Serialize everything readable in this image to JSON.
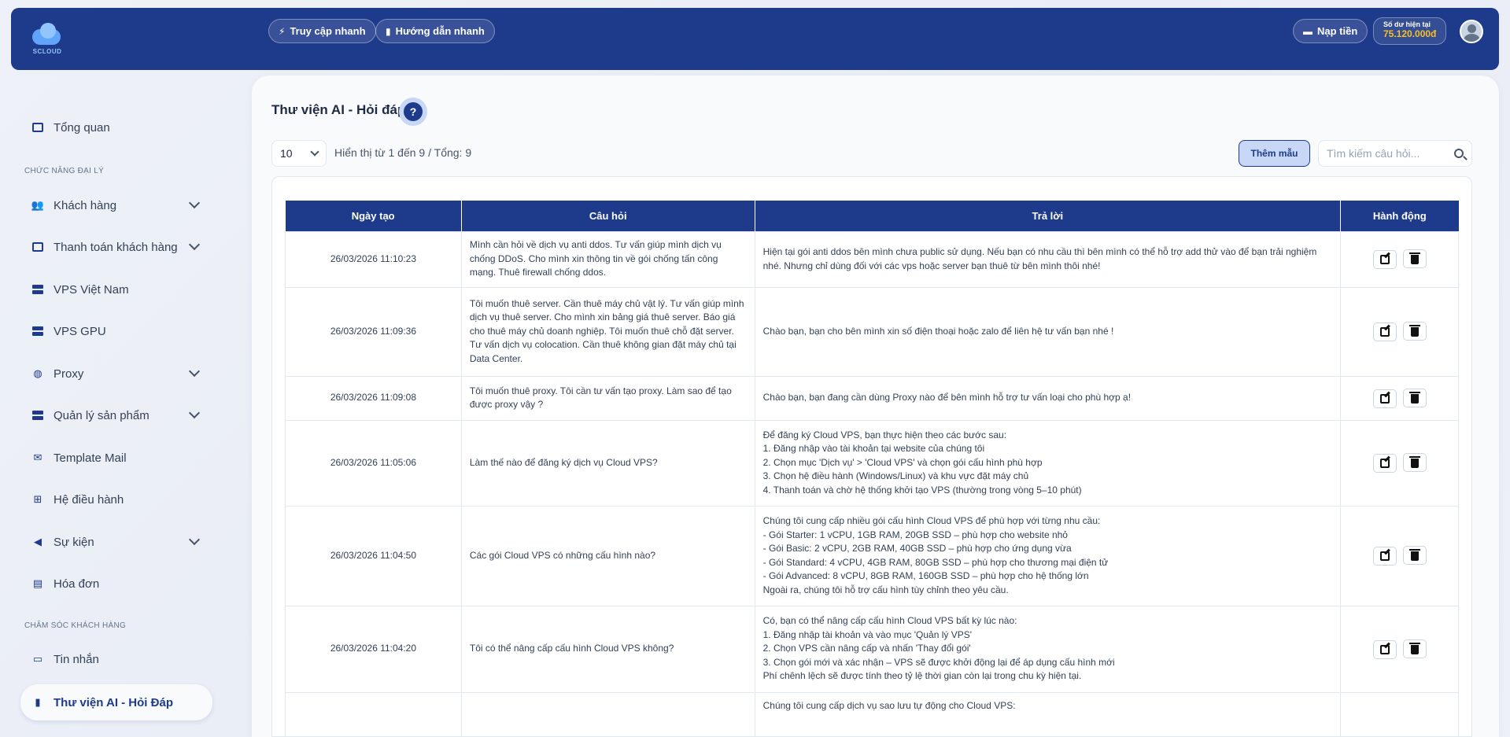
{
  "header": {
    "brand": "SCLOUD",
    "quick_access": "Truy cập nhanh",
    "quick_guide": "Hướng dẫn nhanh",
    "topup": "Nạp tiền",
    "balance_label": "Số dư hiện tại",
    "balance_value": "75.120.000đ"
  },
  "sidebar": {
    "overview": "Tổng quan",
    "section_agent": "CHỨC NĂNG ĐẠI LÝ",
    "items": [
      {
        "label": "Khách hàng"
      },
      {
        "label": "Thanh toán khách hàng"
      },
      {
        "label": "VPS Việt Nam"
      },
      {
        "label": "VPS GPU"
      },
      {
        "label": "Proxy"
      },
      {
        "label": "Quản lý sản phẩm"
      },
      {
        "label": "Template Mail"
      },
      {
        "label": "Hệ điều hành"
      },
      {
        "label": "Sự kiện"
      },
      {
        "label": "Hóa đơn"
      }
    ],
    "section_care": "CHĂM SÓC KHÁCH HÀNG",
    "messages": "Tin nhắn",
    "ai_library": "Thư viện AI - Hỏi Đáp"
  },
  "main": {
    "title": "Thư viện AI - Hỏi đáp",
    "per_page": "10",
    "showing": "Hiển thị từ 1 đến 9 / Tổng: 9",
    "add_button": "Thêm mẫu",
    "search_placeholder": "Tìm kiếm câu hỏi...",
    "columns": [
      "Ngày tạo",
      "Câu hỏi",
      "Trả lời",
      "Hành động"
    ],
    "rows": [
      {
        "date": "26/03/2026 11:10:23",
        "question": "Mình cần hỏi về dịch vụ anti ddos. Tư vấn giúp mình dịch vụ chống DDoS. Cho mình xin thông tin về gói chống tấn công mạng. Thuê firewall chống ddos.",
        "answer": "Hiện tại gói anti ddos bên mình chưa public sử dụng. Nếu bạn có nhu cầu thì bên mình có thể hỗ trợ add thử vào để bạn trải nghiệm nhé. Nhưng chỉ dùng đối với các vps hoặc server bạn thuê từ bên mình thôi nhé!"
      },
      {
        "date": "26/03/2026 11:09:36",
        "question": "Tôi muốn thuê server. Cần thuê máy chủ vật lý. Tư vấn giúp mình dịch vụ thuê server. Cho mình xin bảng giá thuê server. Báo giá cho thuê máy chủ doanh nghiệp. Tôi muốn thuê chỗ đặt server. Tư vấn dịch vụ colocation. Cần thuê không gian đặt máy chủ tại Data Center.",
        "answer": "Chào bạn, bạn cho bên mình xin số điện thoại hoặc zalo để liên hệ tư vấn bạn nhé !"
      },
      {
        "date": "26/03/2026 11:09:08",
        "question": "Tôi muốn thuê proxy. Tôi cần tư vấn tạo proxy. Làm sao để tạo được proxy vậy ?",
        "answer": "Chào bạn, bạn đang cần dùng Proxy nào để bên mình hỗ trợ tư vấn loại cho phù hợp ạ!"
      },
      {
        "date": "26/03/2026 11:05:06",
        "question": "Làm thế nào để đăng ký dịch vụ Cloud VPS?",
        "answer": "Để đăng ký Cloud VPS, bạn thực hiện theo các bước sau:\n1. Đăng nhập vào tài khoản tại website của chúng tôi\n2. Chọn mục 'Dịch vụ' > 'Cloud VPS' và chọn gói cấu hình phù hợp\n3. Chọn hệ điều hành (Windows/Linux) và khu vực đặt máy chủ\n4. Thanh toán và chờ hệ thống khởi tạo VPS (thường trong vòng 5–10 phút)"
      },
      {
        "date": "26/03/2026 11:04:50",
        "question": "Các gói Cloud VPS có những cấu hình nào?",
        "answer": "Chúng tôi cung cấp nhiều gói cấu hình Cloud VPS để phù hợp với từng nhu cầu:\n- Gói Starter: 1 vCPU, 1GB RAM, 20GB SSD – phù hợp cho website nhỏ\n- Gói Basic: 2 vCPU, 2GB RAM, 40GB SSD – phù hợp cho ứng dụng vừa\n- Gói Standard: 4 vCPU, 4GB RAM, 80GB SSD – phù hợp cho thương mại điện tử\n- Gói Advanced: 8 vCPU, 8GB RAM, 160GB SSD – phù hợp cho hệ thống lớn\nNgoài ra, chúng tôi hỗ trợ cấu hình tùy chỉnh theo yêu cầu."
      },
      {
        "date": "26/03/2026 11:04:20",
        "question": "Tôi có thể nâng cấp cấu hình Cloud VPS không?",
        "answer": "Có, bạn có thể nâng cấp cấu hình Cloud VPS bất kỳ lúc nào:\n1. Đăng nhập tài khoản và vào mục 'Quản lý VPS'\n2. Chọn VPS cần nâng cấp và nhấn 'Thay đổi gói'\n3. Chọn gói mới và xác nhận – VPS sẽ được khởi động lại để áp dụng cấu hình mới\nPhí chênh lệch sẽ được tính theo tỷ lệ thời gian còn lại trong chu kỳ hiện tại."
      },
      {
        "date": "",
        "question": "",
        "answer": "Chúng tôi cung cấp dịch vụ sao lưu tự động cho Cloud VPS:"
      }
    ]
  }
}
